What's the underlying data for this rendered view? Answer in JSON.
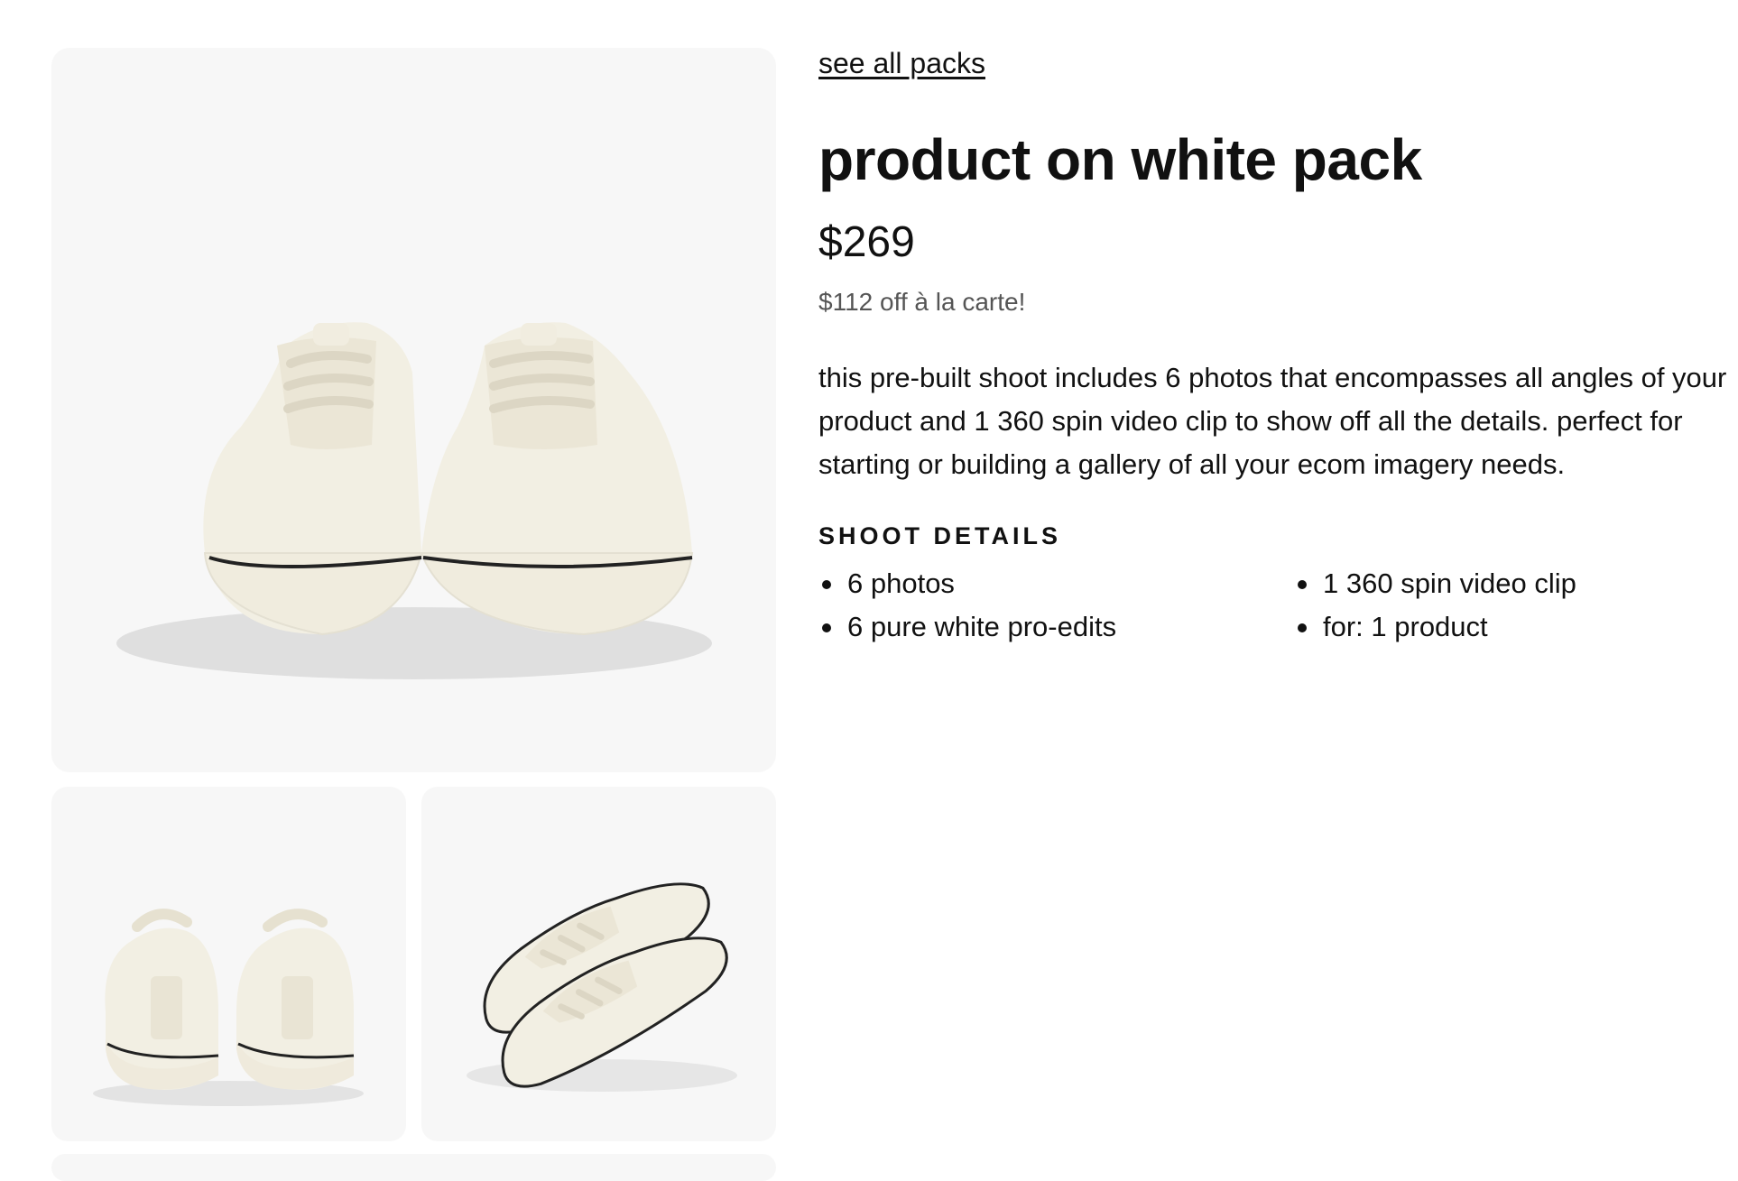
{
  "nav": {
    "back_label": "see all packs"
  },
  "product": {
    "title": "product on white pack",
    "price": "$269",
    "savings": "$112 off à la carte!",
    "description": "this pre-built shoot includes 6 photos that encompasses all angles of your product and 1 360 spin video clip to show off all the details. perfect for starting or building a gallery of all your ecom imagery needs."
  },
  "shoot_details": {
    "heading": "SHOOT DETAILS",
    "items": [
      "6 photos",
      "1 360 spin video clip",
      "6 pure white pro-edits",
      "for: 1 product"
    ]
  },
  "gallery": {
    "images": [
      {
        "icon": "sneakers-front-photo"
      },
      {
        "icon": "sneakers-back-photo"
      },
      {
        "icon": "sneakers-angle-photo"
      }
    ]
  },
  "colors": {
    "image_bg": "#f7f7f7",
    "text": "#111111",
    "muted": "#555555"
  }
}
